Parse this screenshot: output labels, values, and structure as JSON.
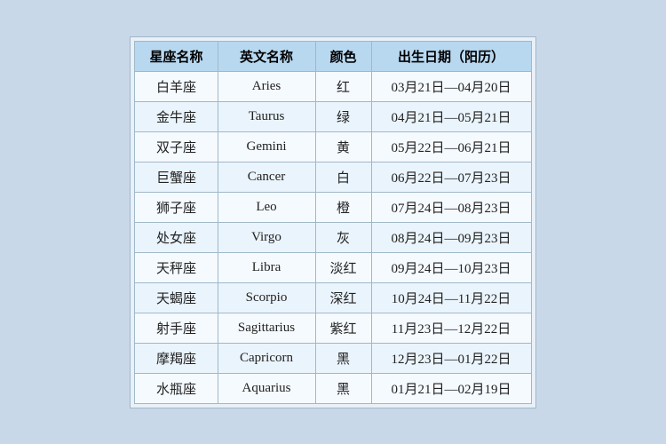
{
  "table": {
    "headers": [
      "星座名称",
      "英文名称",
      "颜色",
      "出生日期（阳历）"
    ],
    "rows": [
      {
        "cn": "白羊座",
        "en": "Aries",
        "color": "红",
        "date": "03月21日—04月20日"
      },
      {
        "cn": "金牛座",
        "en": "Taurus",
        "color": "绿",
        "date": "04月21日—05月21日"
      },
      {
        "cn": "双子座",
        "en": "Gemini",
        "color": "黄",
        "date": "05月22日—06月21日"
      },
      {
        "cn": "巨蟹座",
        "en": "Cancer",
        "color": "白",
        "date": "06月22日—07月23日"
      },
      {
        "cn": "狮子座",
        "en": "Leo",
        "color": "橙",
        "date": "07月24日—08月23日"
      },
      {
        "cn": "处女座",
        "en": "Virgo",
        "color": "灰",
        "date": "08月24日—09月23日"
      },
      {
        "cn": "天秤座",
        "en": "Libra",
        "color": "淡红",
        "date": "09月24日—10月23日"
      },
      {
        "cn": "天蝎座",
        "en": "Scorpio",
        "color": "深红",
        "date": "10月24日—11月22日"
      },
      {
        "cn": "射手座",
        "en": "Sagittarius",
        "color": "紫红",
        "date": "11月23日—12月22日"
      },
      {
        "cn": "摩羯座",
        "en": "Capricorn",
        "color": "黑",
        "date": "12月23日—01月22日"
      },
      {
        "cn": "水瓶座",
        "en": "Aquarius",
        "color": "黑",
        "date": "01月21日—02月19日"
      }
    ]
  }
}
